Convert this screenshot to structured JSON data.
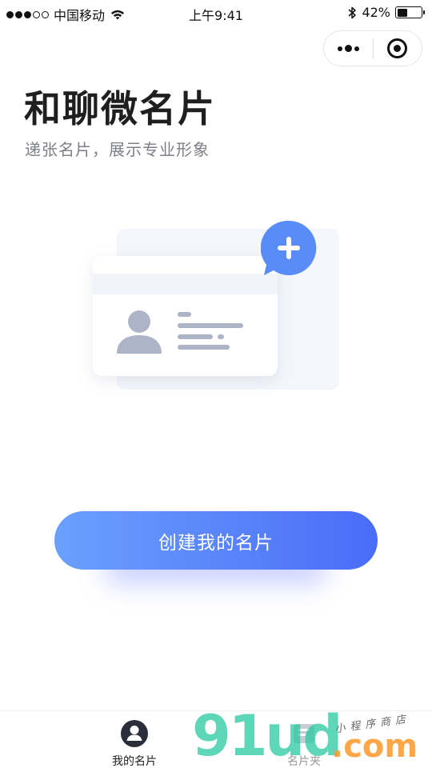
{
  "status_bar": {
    "carrier": "中国移动",
    "time": "上午9:41",
    "battery_text": "42%",
    "battery_level": 0.42,
    "signal_filled": 3,
    "signal_total": 5
  },
  "header": {
    "title": "和聊微名片",
    "subtitle": "递张名片，展示专业形象"
  },
  "main": {
    "create_button_label": "创建我的名片"
  },
  "tabbar": {
    "tabs": [
      {
        "label": "我的名片",
        "icon": "user-circle-icon",
        "active": true
      },
      {
        "label": "名片夹",
        "icon": "card-folder-icon",
        "active": false
      }
    ]
  },
  "watermark": {
    "brand": "91ud",
    "domain": ".com",
    "tagline": "小程序商店"
  },
  "colors": {
    "accent_start": "#6aa0fd",
    "accent_end": "#4a6cf7",
    "illustration_gray": "#aeb4c8",
    "bubble_blue": "#5a8cf8"
  }
}
